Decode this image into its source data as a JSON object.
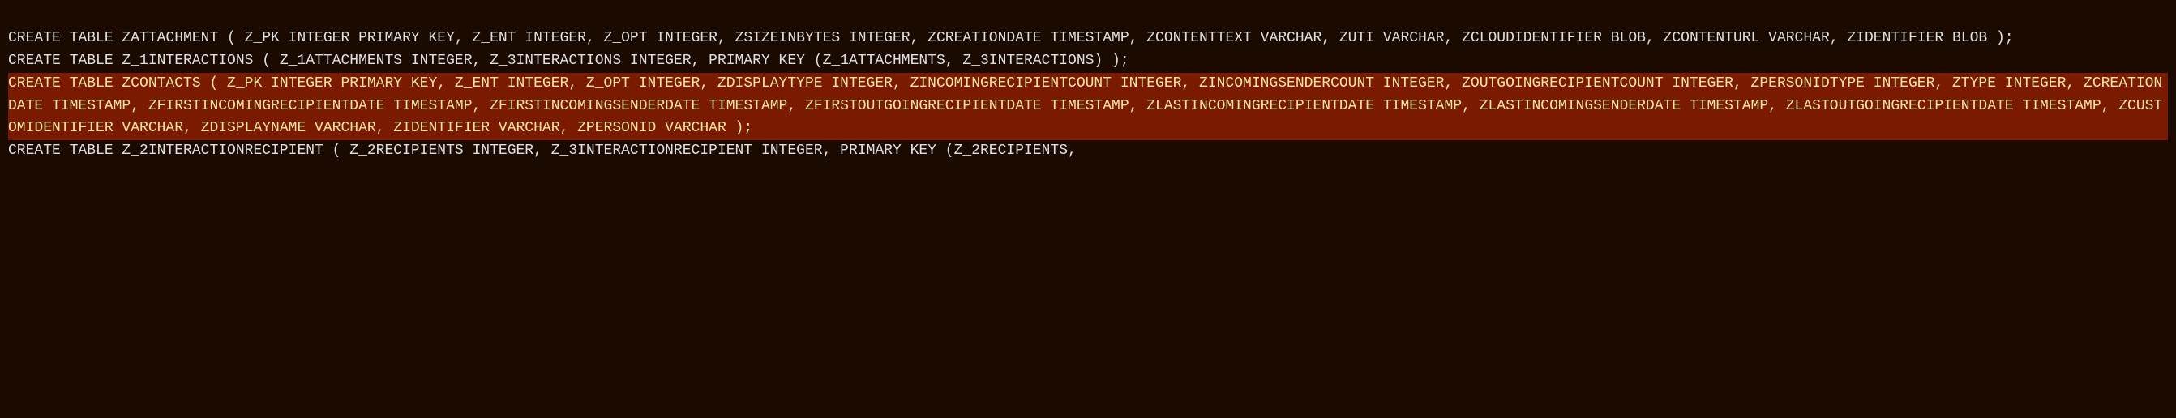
{
  "lines": [
    {
      "highlighted": false,
      "text": "CREATE TABLE ZATTACHMENT ( Z_PK INTEGER PRIMARY KEY, Z_ENT INTEGER, Z_OPT INTEGER, ZSIZEINBYTES INTEGER, ZCREATIONDATE TIMESTAMP, ZCONTENTTEXT VARCHAR, ZUTI VARCHAR, ZCLOUDIDENTIFIER BLOB, ZCONTENTURL VARCHAR, ZIDENTIFIER BLOB );"
    },
    {
      "highlighted": false,
      "text": "CREATE TABLE Z_1INTERACTIONS ( Z_1ATTACHMENTS INTEGER, Z_3INTERACTIONS INTEGER, PRIMARY KEY (Z_1ATTACHMENTS, Z_3INTERACTIONS) );"
    },
    {
      "highlighted": true,
      "text": "CREATE TABLE ZCONTACTS ( Z_PK INTEGER PRIMARY KEY, Z_ENT INTEGER, Z_OPT INTEGER, ZDISPLAYTYPE INTEGER, ZINCOMINGRECIPIENTCOUNT INTEGER, ZINCOMINGSENDERCOUNT INTEGER, ZOUTGOINGRECIPIENTCOUNT INTEGER, ZPERSONIDTYPE INTEGER, ZTYPE INTEGER, ZCREATIONDATE TIMESTAMP, ZFIRSTINCOMINGRECIPIENTDATE TIMESTAMP, ZFIRSTINCOMINGSENDERDATE TIMESTAMP, ZFIRSTOUTGOINGRECIPIENTDATE TIMESTAMP, ZLASTINCOMINGRECIPIENTDATE TIMESTAMP, ZLASTINCOMINGSENDERDATE TIMESTAMP, ZLASTOUTGOINGRECIPIENTDATE TIMESTAMP, ZCUSTOMIDENTIFIER VARCHAR, ZDISPLAYNAME VARCHAR, ZIDENTIFIER VARCHAR, ZPERSONID VARCHAR );"
    },
    {
      "highlighted": false,
      "text": "CREATE TABLE Z_2INTERACTIONRECIPIENT ( Z_2RECIPIENTS INTEGER, Z_3INTERACTIONRECIPIENT INTEGER, PRIMARY KEY (Z_2RECIPIENTS,"
    }
  ]
}
